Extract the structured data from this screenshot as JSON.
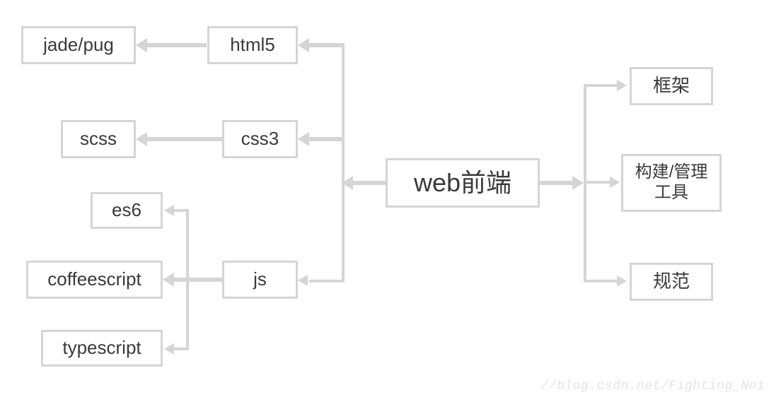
{
  "center": {
    "label": "web前端"
  },
  "left_primary": {
    "html5": "html5",
    "css3": "css3",
    "js": "js"
  },
  "left_secondary": {
    "jade_pug": "jade/pug",
    "scss": "scss",
    "es6": "es6",
    "coffeescript": "coffeescript",
    "typescript": "typescript"
  },
  "right": {
    "frameworks": "框架",
    "build_tools": "构建/管理工具",
    "standards": "规范"
  },
  "watermark": "//blog.csdn.net/Fighting_No1"
}
